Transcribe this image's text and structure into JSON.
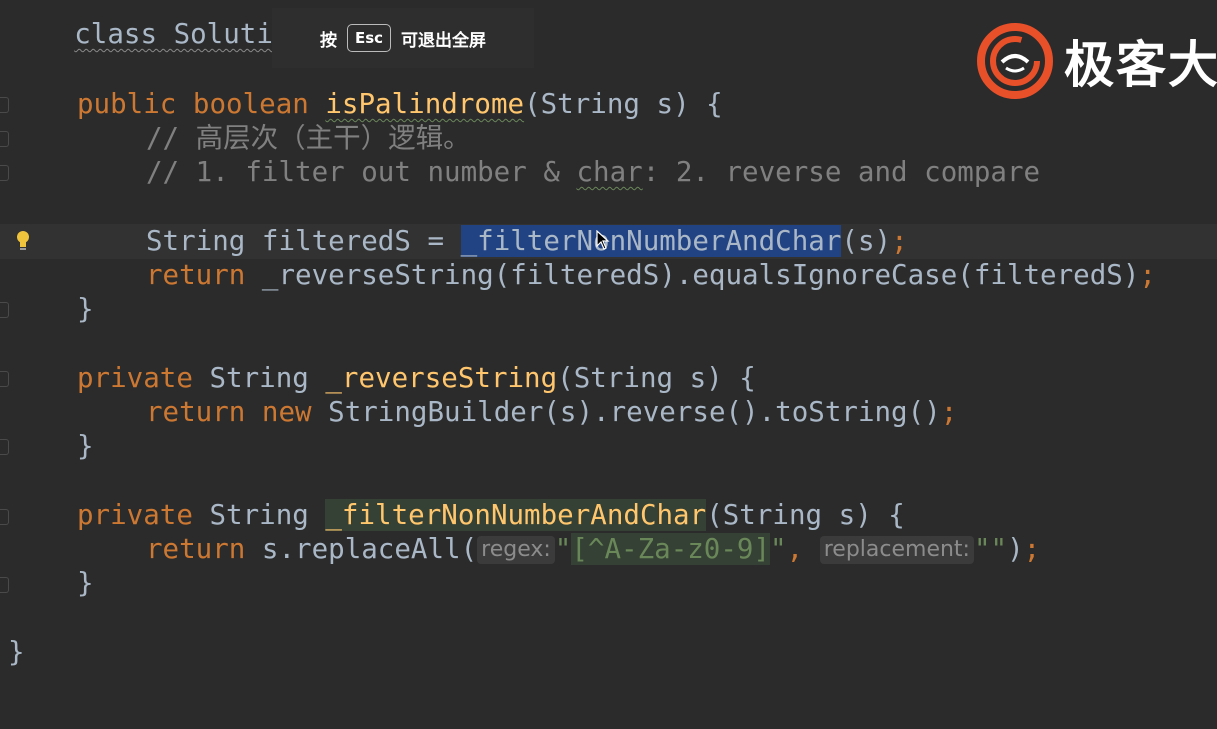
{
  "toast": {
    "press": "按",
    "key": "Esc",
    "action": "可退出全屏"
  },
  "logo": {
    "text": "极客大"
  },
  "colors": {
    "keyword": "#cc7832",
    "method": "#ffc66d",
    "comment": "#808080",
    "string": "#6a8759",
    "selection": "#214283",
    "logo_accent": "#e8502a"
  },
  "code": {
    "class_line": "class Solution {",
    "l1": {
      "kw1": "public",
      "kw2": "boolean",
      "name": "isPalindrome",
      "rest": "(String s) {"
    },
    "l2": "// 高层次（主干）逻辑。",
    "l3a": "// 1. filter out number & ",
    "l3b": "char",
    "l3c": ": 2. reverse and compare",
    "l4": {
      "pre": "String filteredS = ",
      "sel": "_filterNonNumberAndChar",
      "post": "(s)",
      "semi": ";"
    },
    "l5": {
      "kw": "return",
      "rest": "_reverseString(filteredS).equalsIgnoreCase(filteredS)",
      "semi": ";"
    },
    "l6": "}",
    "l7": {
      "kw": "private",
      "type": "String",
      "name": "_reverseString",
      "rest": "(String s) {"
    },
    "l8": {
      "kw": "return",
      "kw2": "new",
      "rest": "StringBuilder(s).reverse().toString()",
      "semi": ";"
    },
    "l9": "}",
    "l10": {
      "kw": "private",
      "type": "String",
      "name": "_filterNonNumberAndChar",
      "rest": "(String s) {"
    },
    "l11": {
      "kw": "return",
      "pre": "s.replaceAll(",
      "hint1": "regex:",
      "q1": "\"",
      "regex": "[^A-Za-z0-9]",
      "q2": "\"",
      "comma": ",",
      "hint2": "replacement:",
      "empty": "\"\"",
      "close": ")",
      "semi": ";"
    },
    "l12": "}",
    "l13": "}"
  }
}
